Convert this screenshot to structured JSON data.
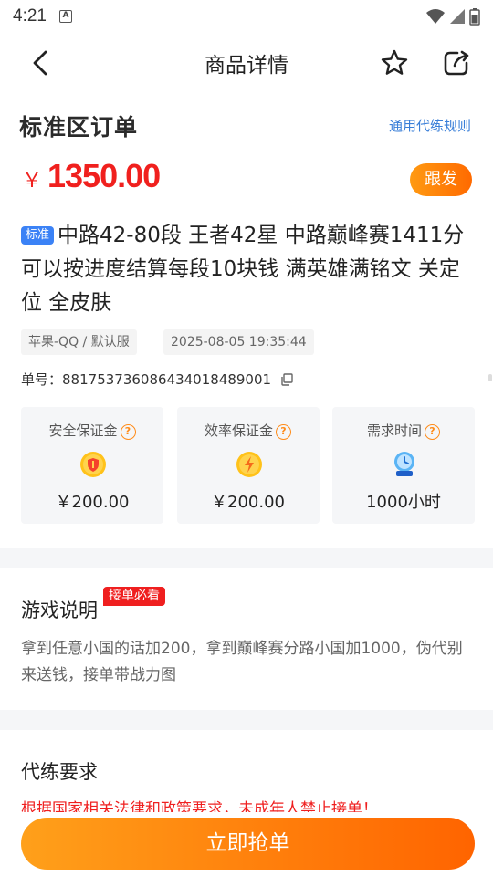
{
  "status_bar": {
    "time": "4:21",
    "notif_icon": "A"
  },
  "nav": {
    "title": "商品详情"
  },
  "order": {
    "zone_title": "标准区订单",
    "rules_link": "通用代练规则",
    "currency": "￥",
    "price": "1350.00",
    "follow_label": "跟发",
    "tag": "标准",
    "description": "中路42-80段 王者42星 中路巅峰赛1411分 可以按进度结算每段10块钱 满英雄满铭文 关定位 全皮肤",
    "server": "苹果-QQ / 默认服",
    "timestamp": "2025-08-05 19:35:44",
    "order_label": "单号：",
    "order_no": "881753736086434018489001"
  },
  "cards": [
    {
      "title": "安全保证金",
      "value": "￥200.00",
      "icon": "shield-coin-icon"
    },
    {
      "title": "效率保证金",
      "value": "￥200.00",
      "icon": "lightning-coin-icon"
    },
    {
      "title": "需求时间",
      "value": "1000小时",
      "icon": "hourglass-icon"
    }
  ],
  "game_section": {
    "title": "游戏说明",
    "badge": "接单必看",
    "text": "拿到任意小国的话加200，拿到巅峰赛分路小国加1000，伪代别来送钱，接单带战力图"
  },
  "requirements": {
    "title": "代练要求",
    "text": "根据国家相关法律和政策要求，未成年人禁止接单！"
  },
  "bottom": {
    "grab_label": "立即抢单"
  },
  "colors": {
    "accent": "#ff7a00",
    "price": "#f0201e",
    "link": "#3a7fd8",
    "tag": "#3b82f6"
  }
}
